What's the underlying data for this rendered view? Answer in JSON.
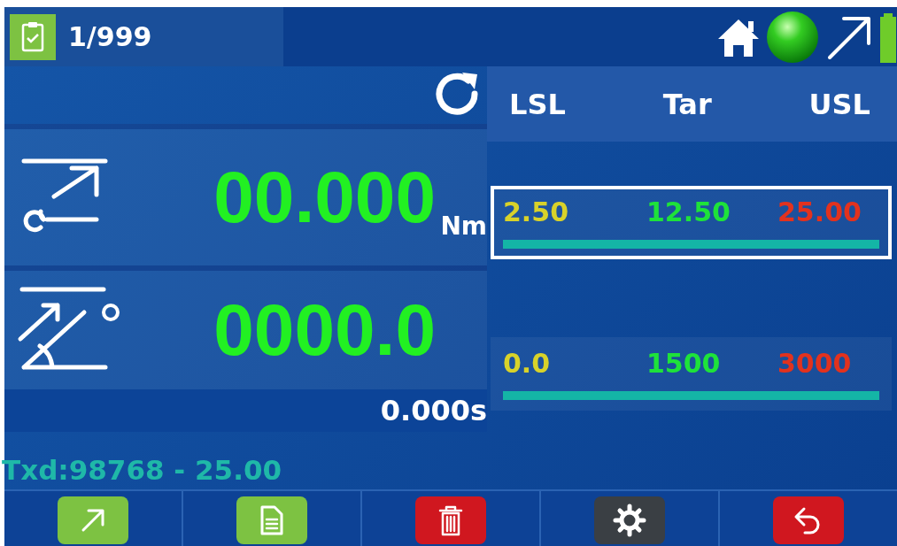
{
  "header": {
    "counter": "1/999"
  },
  "readings": [
    {
      "kind": "torque",
      "value": "00.000",
      "unit": "Nm"
    },
    {
      "kind": "angle",
      "value": "0000.0"
    }
  ],
  "time": "0.000s",
  "transducer": "Txd:98768 - 25.00",
  "limits": {
    "columns": [
      "LSL",
      "Tar",
      "USL"
    ],
    "rows": [
      {
        "lsl": "2.50",
        "tar": "12.50",
        "usl": "25.00",
        "selected": true
      },
      {
        "lsl": "0.0",
        "tar": "1500",
        "usl": "3000",
        "selected": false
      }
    ]
  },
  "toolbar": [
    {
      "kind": "arrow",
      "color": "#7dc242"
    },
    {
      "kind": "document",
      "color": "#7dc242"
    },
    {
      "kind": "trash",
      "color": "#d0171f"
    },
    {
      "kind": "settings",
      "color": "#3a3f44"
    },
    {
      "kind": "back",
      "color": "#d0171f"
    }
  ]
}
